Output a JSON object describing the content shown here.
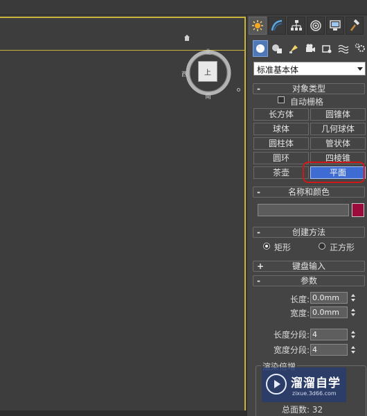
{
  "viewport": {
    "compass": {
      "north": "北",
      "west": "西",
      "south": "南",
      "cube_face": "上"
    }
  },
  "panel": {
    "tabs": [
      {
        "name": "create",
        "icon": "sun-star-icon"
      },
      {
        "name": "modify",
        "icon": "curve-icon"
      },
      {
        "name": "hierarchy",
        "icon": "hierarchy-icon"
      },
      {
        "name": "motion",
        "icon": "motion-icon"
      },
      {
        "name": "display",
        "icon": "monitor-icon"
      },
      {
        "name": "utilities",
        "icon": "hammer-icon"
      }
    ],
    "category_icons": [
      "geometry-sphere-icon",
      "shapes-icon",
      "lights-icon",
      "cameras-icon",
      "helpers-icon",
      "spacewarps-icon",
      "systems-icon"
    ],
    "dropdown": {
      "selected": "标准基本体"
    },
    "object_type": {
      "header": "对象类型",
      "toggle": "-",
      "autogrid_label": "自动栅格",
      "buttons": [
        [
          "长方体",
          "圆锥体"
        ],
        [
          "球体",
          "几何球体"
        ],
        [
          "圆柱体",
          "管状体"
        ],
        [
          "圆环",
          "四棱锥"
        ],
        [
          "茶壶",
          "平面"
        ]
      ],
      "selected": "平面"
    },
    "name_color": {
      "header": "名称和颜色",
      "toggle": "-",
      "name_value": "",
      "color": "#9b0c3c"
    },
    "creation_method": {
      "header": "创建方法",
      "toggle": "-",
      "options": [
        "矩形",
        "正方形"
      ],
      "selected": "矩形"
    },
    "keyboard_entry": {
      "header": "键盘输入",
      "toggle": "+"
    },
    "parameters": {
      "header": "参数",
      "toggle": "-",
      "length_label": "长度:",
      "length_value": "0.0mm",
      "width_label": "宽度:",
      "width_value": "0.0mm",
      "length_segs_label": "长度分段:",
      "length_segs_value": "4",
      "width_segs_label": "宽度分段:",
      "width_segs_value": "4",
      "render_group_label": "渲染倍增",
      "total_faces_label": "总面数: 32"
    }
  },
  "watermark": {
    "title": "溜溜自学",
    "url": "zixue.3d66.com"
  }
}
